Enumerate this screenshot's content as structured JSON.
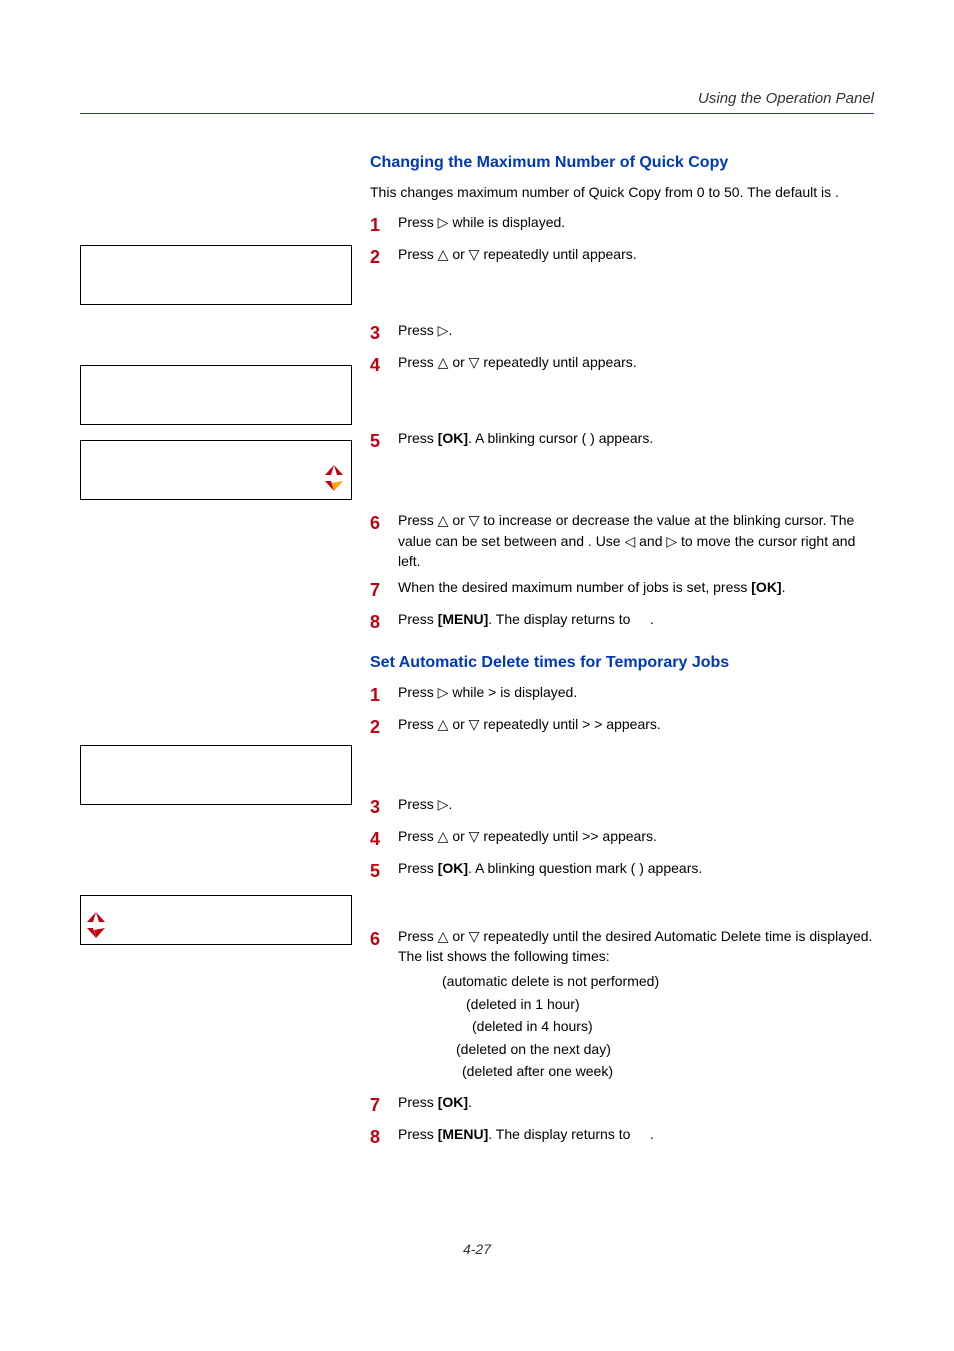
{
  "header": {
    "title": "Using the Operation Panel"
  },
  "section1": {
    "heading": "Changing the Maximum Number of Quick Copy",
    "intro": "This changes maximum number of Quick Copy from 0 to 50. The default is .",
    "steps": {
      "s1": "Press ▷ while          is displayed.",
      "s2": "Press △ or ▽ repeatedly until appears.",
      "s3": "Press ▷.",
      "s4": "Press △ or ▽ repeatedly until                appears.",
      "s5": "Press [OK]. A blinking cursor ( ) appears.",
      "s6": "Press △ or ▽ to increase or decrease the value at the blinking cursor. The value can be set between    and    . Use ◁ and ▷ to move the cursor right and left.",
      "s7": "When the desired maximum number of jobs is set, press [OK].",
      "s8": "Press [MENU]. The display returns to        ."
    }
  },
  "section2": {
    "heading": "Set Automatic Delete times for Temporary Jobs",
    "steps": {
      "s1": "Press ▷ while          > is displayed.",
      "s2": "Press △ or ▽ repeatedly until >                                        > appears.",
      "s3": "Press ▷.",
      "s4": "Press △ or ▽ repeatedly until >>           appears.",
      "s5": "Press [OK]. A blinking question mark ( ) appears.",
      "s6a": "Press △ or ▽ repeatedly until the desired Automatic Delete time is displayed. The list shows the following times:",
      "s6_list": {
        "l1": "(automatic delete is not performed)",
        "l2": "(deleted in 1 hour)",
        "l3": "(deleted in 4 hours)",
        "l4": "(deleted on the next day)",
        "l5": "(deleted after one week)"
      },
      "s7": "Press [OK].",
      "s8": "Press [MENU]. The display returns to        ."
    }
  },
  "footer": {
    "pagenum": "4-27"
  },
  "chart_data": {
    "type": "table",
    "note": "No chart present; document page of operation manual.",
    "values": []
  }
}
